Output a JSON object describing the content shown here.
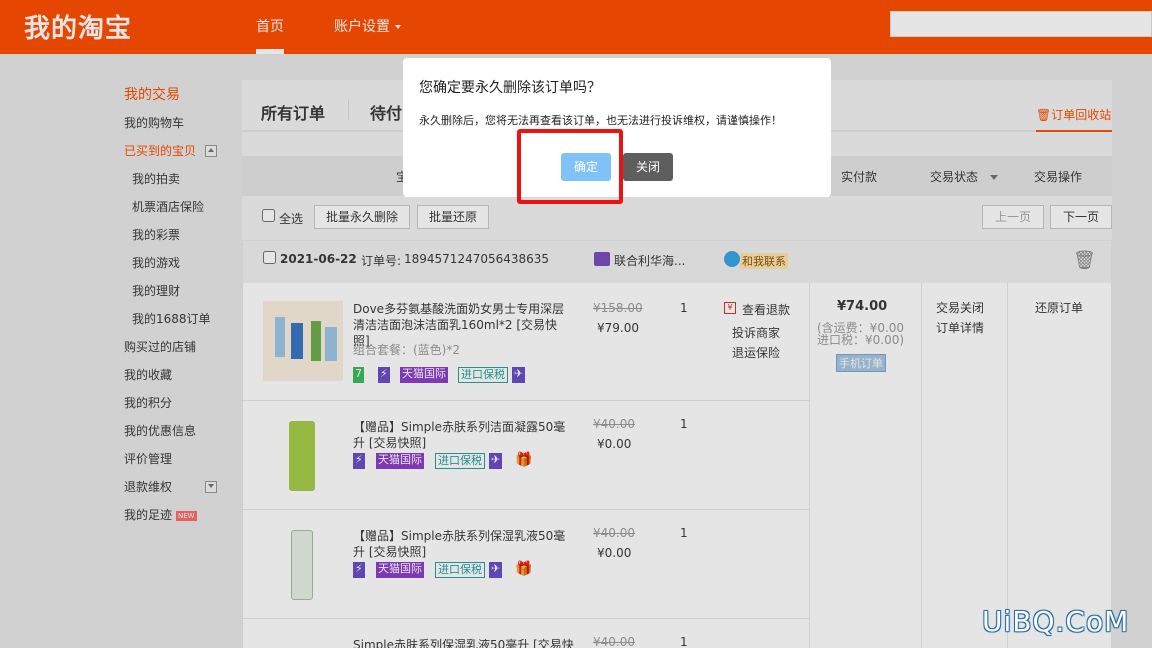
{
  "header": {
    "logo": "我的淘宝",
    "nav_home": "首页",
    "nav_account": "账户设置",
    "search_placeholder": ""
  },
  "sidebar": {
    "section": "我的交易",
    "items": [
      {
        "label": "我的购物车"
      },
      {
        "label": "已买到的宝贝"
      },
      {
        "label": "我的拍卖"
      },
      {
        "label": "机票酒店保险"
      },
      {
        "label": "我的彩票"
      },
      {
        "label": "我的游戏"
      },
      {
        "label": "我的理财"
      },
      {
        "label": "我的1688订单"
      },
      {
        "label": "购买过的店铺"
      },
      {
        "label": "我的收藏"
      },
      {
        "label": "我的积分"
      },
      {
        "label": "我的优惠信息"
      },
      {
        "label": "评价管理"
      },
      {
        "label": "退款维权"
      },
      {
        "label": "我的足迹"
      }
    ],
    "new_badge": "NEW"
  },
  "tabs": {
    "all": "所有订单",
    "pending": "待付",
    "recycle": "订单回收站"
  },
  "thead": {
    "goods": "宝",
    "paid": "实付款",
    "status": "交易状态",
    "action": "交易操作"
  },
  "toolbar": {
    "select_all": "全选",
    "batch_delete": "批量永久删除",
    "batch_restore": "批量还原",
    "prev": "上一页",
    "next": "下一页"
  },
  "order": {
    "date": "2021-06-22",
    "order_no_label": "订单号:",
    "order_no": "1894571247056438635",
    "shop": "联合利华海...",
    "contact": "和我联系",
    "paid": "¥74.00",
    "shipping": "(含运费：¥0.00",
    "tax": "进口税：¥0.00)",
    "mobile": "手机订单",
    "status_closed": "交易关闭",
    "status_detail": "订单详情",
    "restore": "还原订单",
    "refund": "查看退款",
    "complain": "投诉商家",
    "insurance": "退运保险",
    "items": [
      {
        "title": "Dove多芬氨基酸洗面奶女男士专用深层清洁洁面泡沫洁面乳160ml*2 [交易快照]",
        "option": "组合套餐：(蓝色)*2",
        "price_old": "¥158.00",
        "price_new": "¥79.00",
        "qty": "1"
      },
      {
        "title": "【赠品】Simple赤肤系列洁面凝露50毫升 [交易快照]",
        "price_old": "¥40.00",
        "price_new": "¥0.00",
        "qty": "1"
      },
      {
        "title": "【赠品】Simple赤肤系列保湿乳液50毫升 [交易快照]",
        "price_old": "¥40.00",
        "price_new": "¥0.00",
        "qty": "1"
      },
      {
        "title": "Simple赤肤系列保湿乳液50毫升 [交易快",
        "price_old": "¥40.00",
        "qty": "1"
      }
    ],
    "tags": {
      "tmall": "天猫国际",
      "bonded": "进口保税"
    }
  },
  "dialog": {
    "title": "您确定要永久删除该订单吗？",
    "message": "永久删除后，您将无法再查看该订单，也无法进行投诉维权，请谨慎操作！",
    "confirm": "确定",
    "close": "关闭"
  },
  "watermark": "UiBQ.CoM"
}
